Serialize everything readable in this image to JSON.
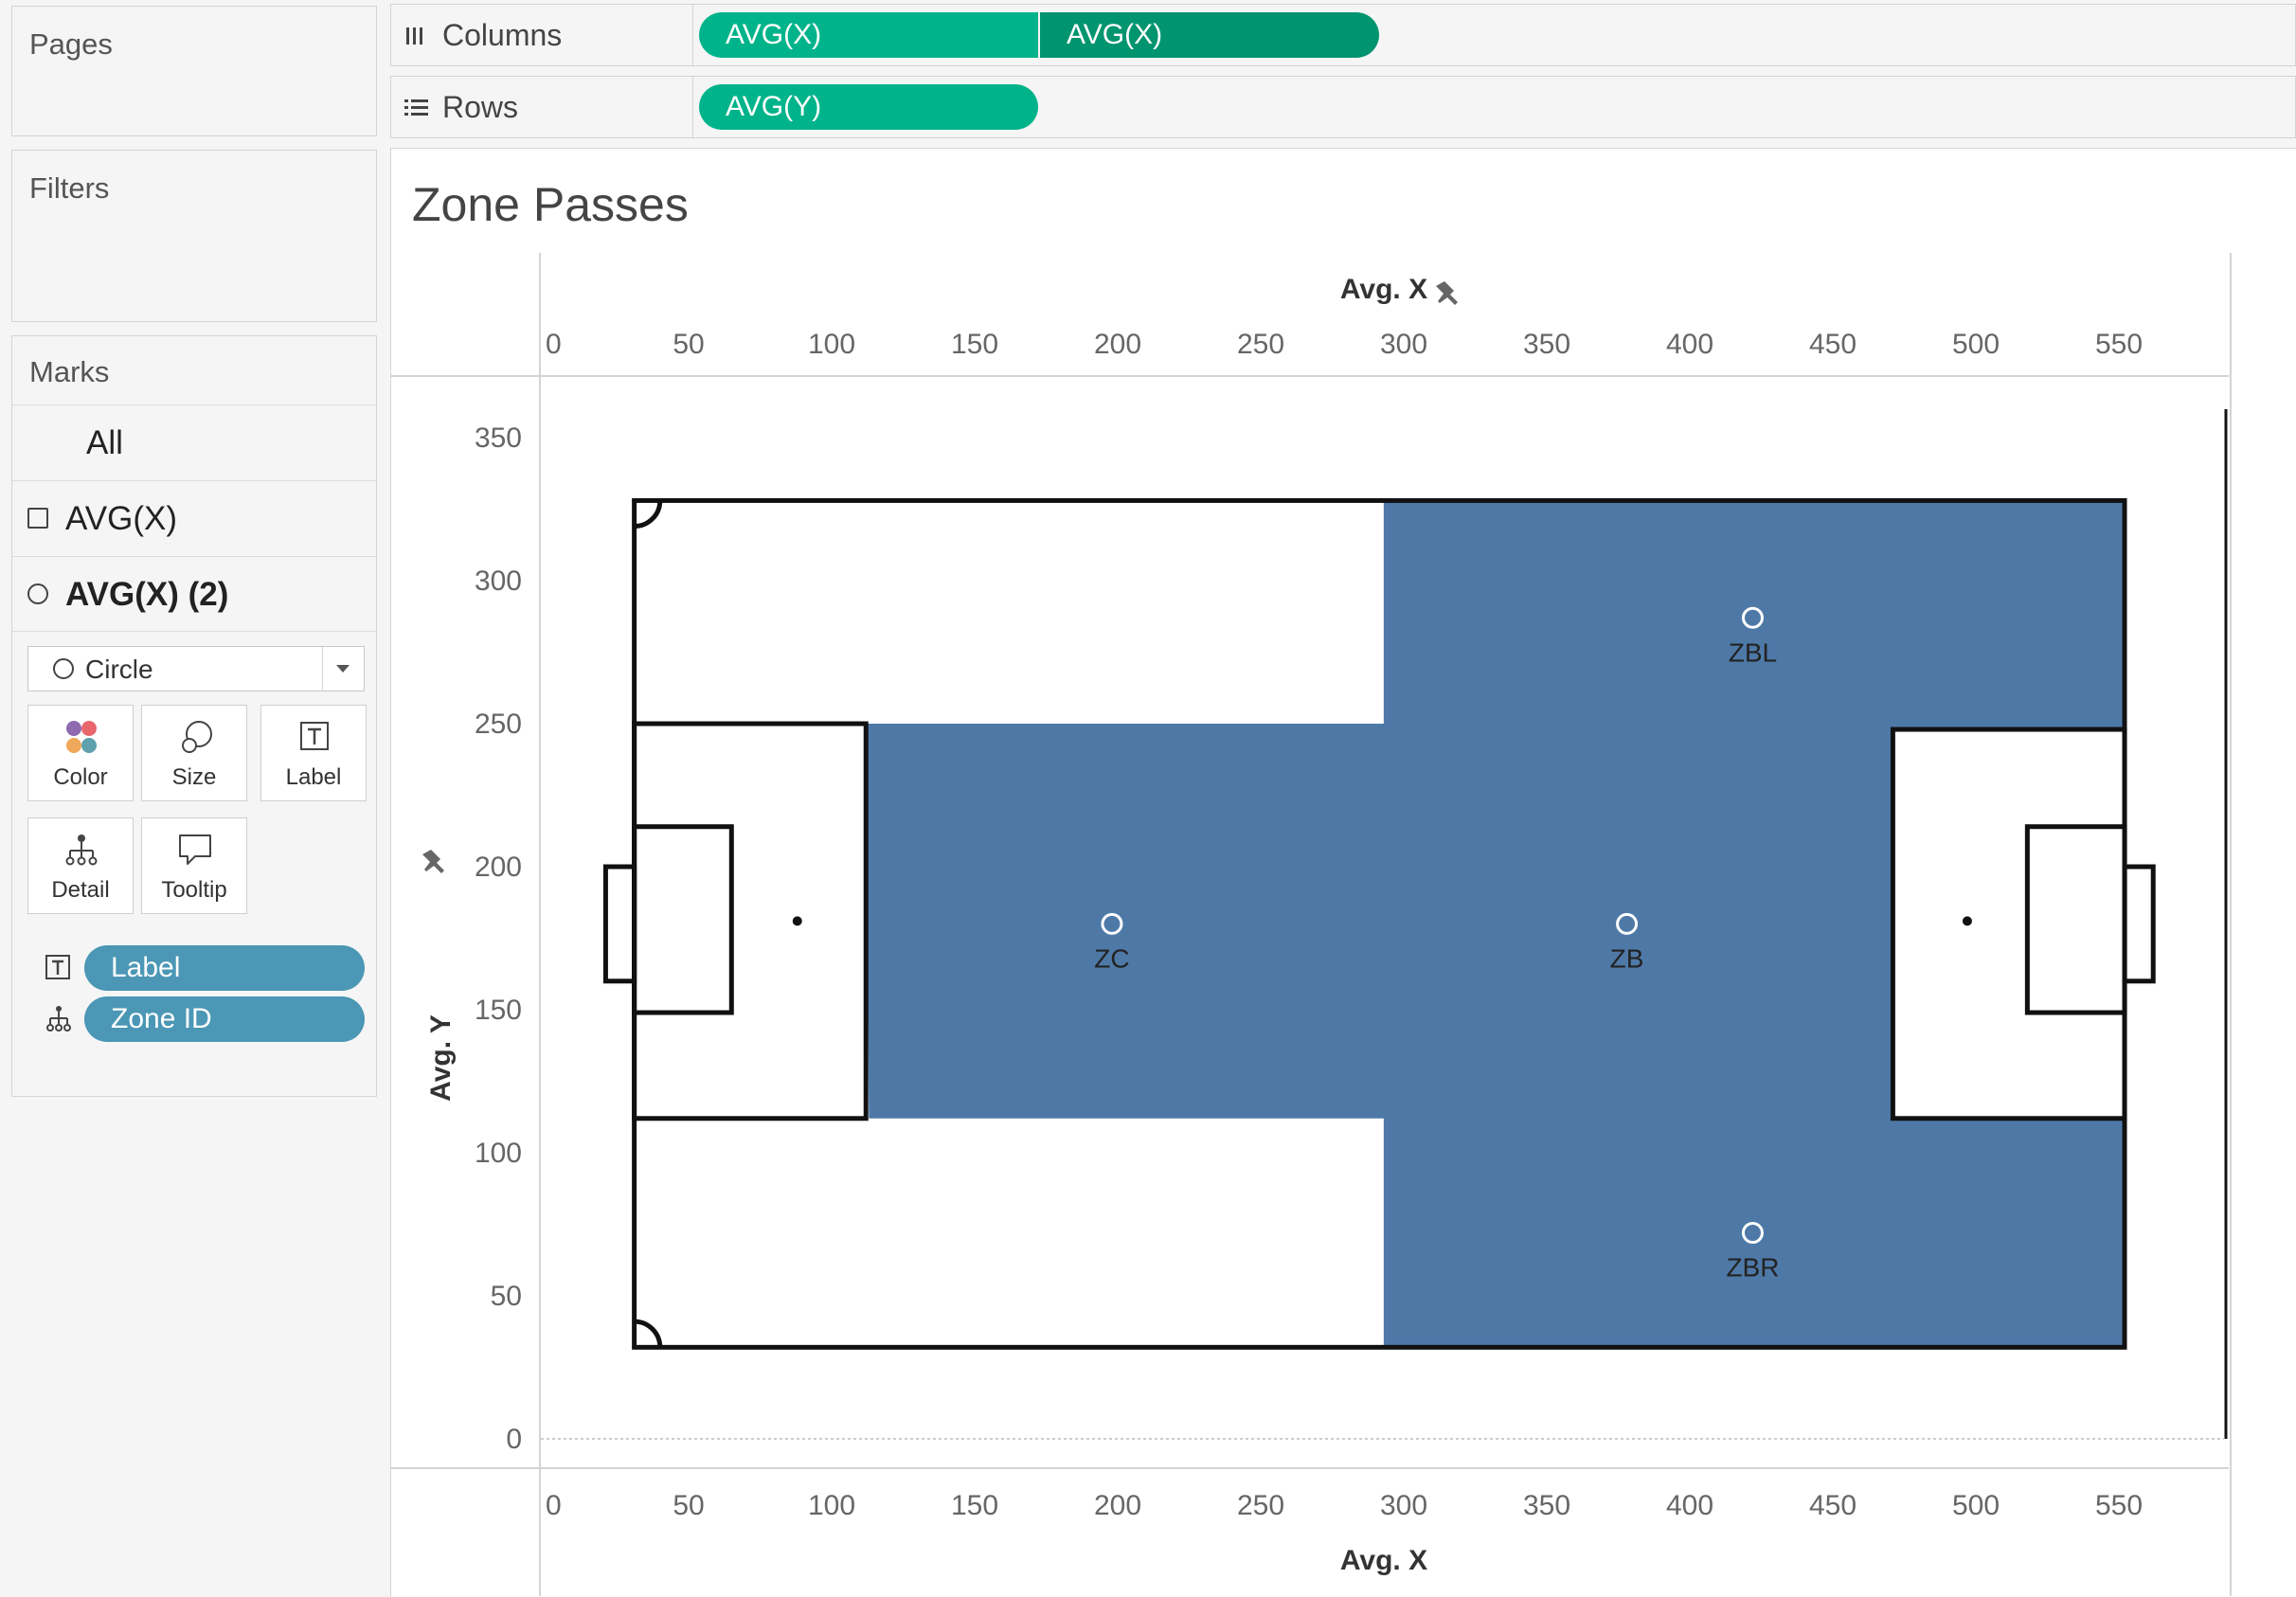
{
  "pages": {
    "title": "Pages"
  },
  "filters": {
    "title": "Filters"
  },
  "marks": {
    "title": "Marks",
    "items": [
      {
        "label": "All"
      },
      {
        "label": "AVG(X)"
      },
      {
        "label": "AVG(X) (2)"
      }
    ],
    "mark_type": "Circle",
    "cards": [
      {
        "label": "Color",
        "icon": "color-icon"
      },
      {
        "label": "Size",
        "icon": "size-icon"
      },
      {
        "label": "Label",
        "icon": "label-icon"
      },
      {
        "label": "Detail",
        "icon": "detail-icon"
      },
      {
        "label": "Tooltip",
        "icon": "tooltip-icon"
      }
    ],
    "fields": [
      {
        "label": "Label",
        "icon": "label-icon"
      },
      {
        "label": "Zone ID",
        "icon": "detail-icon"
      }
    ]
  },
  "shelves": {
    "columns": {
      "label": "Columns",
      "pills": [
        "AVG(X)",
        "AVG(X)"
      ]
    },
    "rows": {
      "label": "Rows",
      "pills": [
        "AVG(Y)"
      ]
    }
  },
  "colors": {
    "pill_green": "#00b38a",
    "pill_green_dark": "#00946f",
    "field_blue": "#4b97b5",
    "zone_fill": "#4e79a7"
  },
  "chart_data": {
    "type": "scatter",
    "title": "Zone Passes",
    "xlabel": "Avg. X",
    "ylabel": "Avg. Y",
    "xlim": [
      0,
      585
    ],
    "ylim": [
      0,
      350
    ],
    "x_ticks": [
      0,
      50,
      100,
      150,
      200,
      250,
      300,
      350,
      400,
      450,
      500,
      550
    ],
    "y_ticks": [
      0,
      50,
      100,
      150,
      200,
      250,
      300,
      350
    ],
    "x_tick_labels": [
      "0",
      "50",
      "100",
      "150",
      "200",
      "250",
      "300",
      "350",
      "400",
      "450",
      "500",
      "550"
    ],
    "y_tick_labels": [
      "0",
      "50",
      "100",
      "150",
      "200",
      "250",
      "300",
      "350"
    ],
    "points": [
      {
        "label": "ZBL",
        "x": 422,
        "y": 287
      },
      {
        "label": "ZC",
        "x": 198,
        "y": 180
      },
      {
        "label": "ZB",
        "x": 378,
        "y": 180
      },
      {
        "label": "ZBR",
        "x": 422,
        "y": 72
      }
    ],
    "zone_polygon": [
      [
        293,
        328
      ],
      [
        552,
        328
      ],
      [
        552,
        248
      ],
      [
        471,
        248
      ],
      [
        471,
        112
      ],
      [
        552,
        112
      ],
      [
        552,
        32
      ],
      [
        293,
        32
      ],
      [
        293,
        112
      ],
      [
        113,
        112
      ],
      [
        112,
        250
      ],
      [
        293,
        250
      ]
    ],
    "pitch": {
      "outline": [
        31,
        32,
        552,
        328
      ],
      "penalty_left": [
        31,
        112,
        112,
        250
      ],
      "box_left": [
        31,
        149,
        65,
        214
      ],
      "goal_left": [
        21,
        160,
        31,
        200
      ],
      "spot_left": [
        88,
        181
      ],
      "penalty_right": [
        471,
        112,
        552,
        248
      ],
      "box_right": [
        518,
        149,
        552,
        214
      ],
      "goal_right": [
        552,
        160,
        562,
        200
      ],
      "spot_right": [
        497,
        181
      ],
      "corner_radius": 9
    }
  }
}
